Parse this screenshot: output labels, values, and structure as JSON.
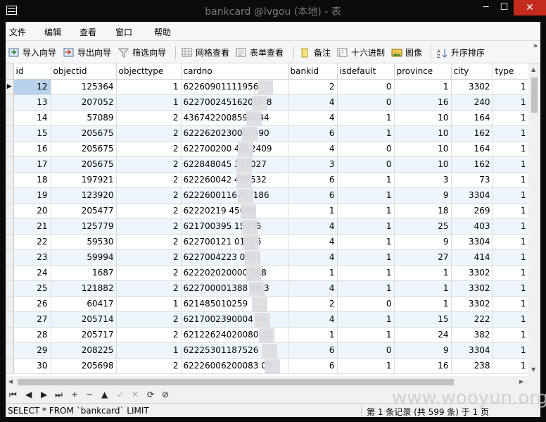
{
  "window": {
    "title": "bankcard @lvgou (本地) - 表",
    "min": "─",
    "max": "☐",
    "close": "✕"
  },
  "menu": [
    "文件",
    "编辑",
    "查看",
    "窗口",
    "帮助"
  ],
  "toolbar": {
    "import": "导入向导",
    "export": "导出向导",
    "filter": "筛选向导",
    "grid_view": "网格查看",
    "form_view": "表单查看",
    "memo": "备注",
    "hex": "十六进制",
    "image": "图像",
    "sort_asc": "升序排序",
    "more": "»"
  },
  "columns": [
    "id",
    "objectid",
    "objecttype",
    "cardno",
    "bankid",
    "isdefault",
    "province",
    "city",
    "type"
  ],
  "rows": [
    [
      "12",
      "125364",
      "1",
      "62260901111956",
      "2",
      "0",
      "1",
      "3302",
      "1"
    ],
    [
      "13",
      "207052",
      "1",
      "622700245162016  8",
      "4",
      "0",
      "16",
      "240",
      "1"
    ],
    [
      "14",
      "57089",
      "2",
      "4367422008590044",
      "4",
      "1",
      "10",
      "164",
      "1"
    ],
    [
      "15",
      "205675",
      "2",
      "6222620230007390",
      "6",
      "1",
      "10",
      "162",
      "1"
    ],
    [
      "16",
      "205675",
      "2",
      "622700200  4012409",
      "4",
      "0",
      "10",
      "164",
      "1"
    ],
    [
      "17",
      "205675",
      "2",
      "622848045  327027",
      "3",
      "0",
      "10",
      "162",
      "1"
    ],
    [
      "18",
      "197921",
      "2",
      "622260042  408532",
      "6",
      "1",
      "3",
      "73",
      "1"
    ],
    [
      "19",
      "123920",
      "2",
      "6222600116757186",
      "6",
      "1",
      "9",
      "3304",
      "1"
    ],
    [
      "20",
      "205477",
      "2",
      "62220219  45668",
      "1",
      "1",
      "18",
      "269",
      "1"
    ],
    [
      "21",
      "125779",
      "2",
      "621700395  15036",
      "4",
      "1",
      "25",
      "403",
      "1"
    ],
    [
      "22",
      "59530",
      "2",
      "622700121  01126",
      "4",
      "1",
      "9",
      "3304",
      "1"
    ],
    [
      "23",
      "59994",
      "2",
      "6227004223  0551",
      "4",
      "1",
      "27",
      "414",
      "1"
    ],
    [
      "24",
      "1687",
      "2",
      "622202020000  508",
      "1",
      "1",
      "1",
      "3302",
      "1"
    ],
    [
      "25",
      "121882",
      "2",
      "622700001388  46  3",
      "4",
      "1",
      "1",
      "3302",
      "1"
    ],
    [
      "26",
      "60417",
      "1",
      "621485010259",
      "2",
      "0",
      "1",
      "3302",
      "1"
    ],
    [
      "27",
      "205714",
      "2",
      "6217002390004  90",
      "4",
      "1",
      "15",
      "222",
      "1"
    ],
    [
      "28",
      "205717",
      "2",
      "62122624020080  15",
      "1",
      "1",
      "24",
      "382",
      "1"
    ],
    [
      "29",
      "208225",
      "1",
      "62225301187526",
      "6",
      "0",
      "9",
      "3304",
      "1"
    ],
    [
      "30",
      "205698",
      "2",
      "62226006200083  05",
      "6",
      "1",
      "16",
      "238",
      "1"
    ]
  ],
  "selected_row_index": 0,
  "nav": [
    "⏮",
    "◀",
    "▶",
    "⏭",
    "+",
    "−",
    "▲",
    "✓",
    "✕",
    "⟳",
    "⊘"
  ],
  "status": {
    "sql": "SELECT * FROM `bankcard` LIMIT",
    "records": "第 1 条记录 (共 599 条) 于 1 页",
    "watermark": "www.wooyun.org"
  }
}
